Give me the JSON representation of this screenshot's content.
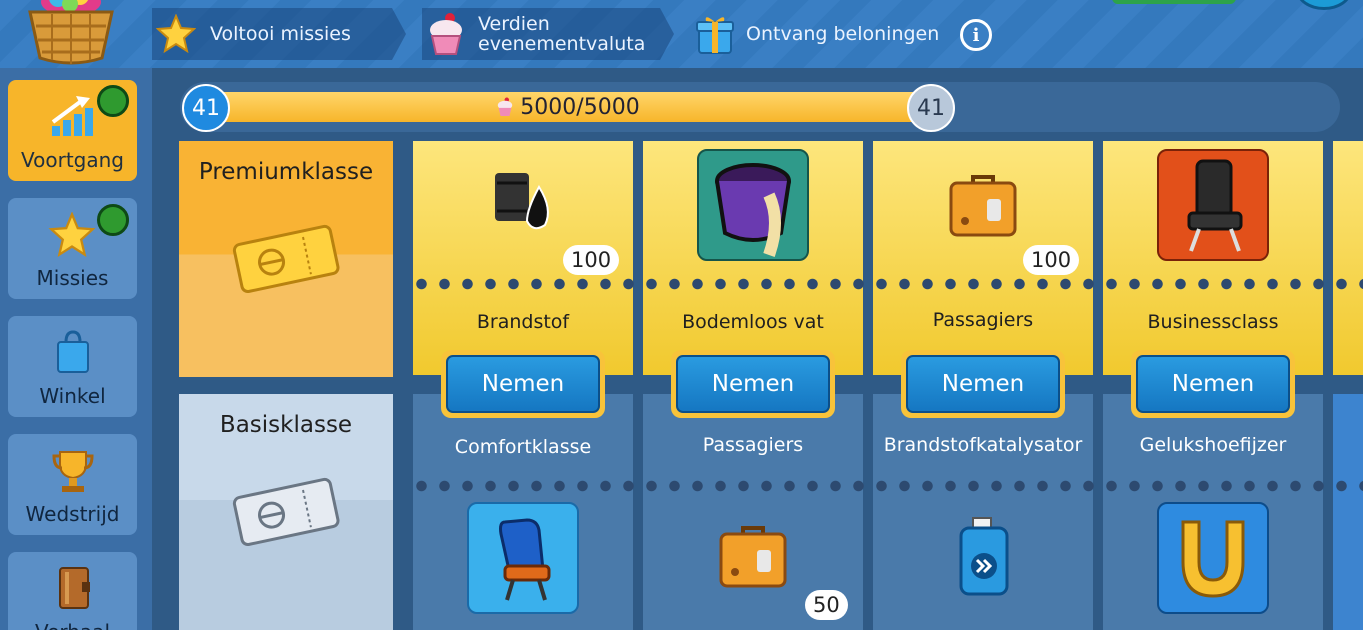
{
  "header": {
    "steps": [
      {
        "label": "Voltooi missies",
        "icon": "star-icon"
      },
      {
        "label_line1": "Verdien",
        "label_line2": "evenementvaluta",
        "icon": "cupcake-icon"
      },
      {
        "label": "Ontvang beloningen",
        "icon": "gift-box-icon"
      }
    ],
    "info_icon": "info-icon"
  },
  "sidebar": {
    "items": [
      {
        "label": "Voortgang",
        "icon": "progress-chart-icon",
        "active": true,
        "has_gift": true
      },
      {
        "label": "Missies",
        "icon": "star-icon",
        "active": false,
        "has_gift": true
      },
      {
        "label": "Winkel",
        "icon": "shopping-bag-icon",
        "active": false,
        "has_gift": false
      },
      {
        "label": "Wedstrijd",
        "icon": "trophy-icon",
        "active": false,
        "has_gift": false
      },
      {
        "label": "Verhaal",
        "icon": "book-icon",
        "active": false,
        "has_gift": false
      }
    ]
  },
  "progress": {
    "level_current": "41",
    "level_next": "41",
    "text": "5000/5000",
    "fraction": 1.0
  },
  "tiers": {
    "premium_label": "Premiumklasse",
    "basic_label": "Basisklasse"
  },
  "rewards": [
    {
      "premium": {
        "name": "Brandstof",
        "qty": "100",
        "icon": "fuel-barrel-icon"
      },
      "button": "Nemen",
      "basic": {
        "name": "Comfortklasse",
        "qty": "",
        "icon": "comfort-seat-icon"
      }
    },
    {
      "premium": {
        "name": "Bodemloos vat",
        "qty": "",
        "icon": "bottomless-barrel-icon"
      },
      "button": "Nemen",
      "basic": {
        "name": "Passagiers",
        "qty": "50",
        "icon": "suitcase-icon"
      }
    },
    {
      "premium": {
        "name": "Passagiers",
        "qty": "100",
        "icon": "suitcase-icon"
      },
      "button": "Nemen",
      "basic": {
        "name": "Brandstofkatalysator",
        "qty": "",
        "icon": "fuel-catalyst-icon"
      }
    },
    {
      "premium": {
        "name": "Businessclass",
        "qty": "",
        "icon": "business-seat-icon"
      },
      "button": "Nemen",
      "basic": {
        "name": "Gelukshoefijzer",
        "qty": "",
        "icon": "horseshoe-icon"
      }
    }
  ],
  "colors": {
    "gold": "#f7b52a",
    "blue_button": "#1a86d0",
    "level_badge": "#1f8ae0"
  }
}
